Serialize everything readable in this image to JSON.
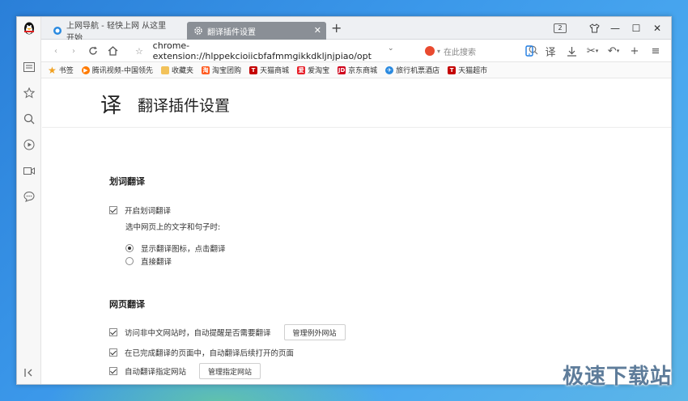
{
  "tabs": [
    {
      "label": "上网导航 - 轻快上网 从这里开始",
      "active": false
    },
    {
      "label": "翻译插件设置",
      "active": true
    }
  ],
  "tab_counter": "2",
  "address": {
    "url": "chrome-extension://hlppekcioiicbfafmmgikkdkljnjpiao/opt"
  },
  "search": {
    "placeholder": "在此搜索"
  },
  "toolbar": {
    "translate_label": "译"
  },
  "bookmarks": [
    {
      "label": "书签",
      "icon": "star-icon",
      "color": "#f0a020"
    },
    {
      "label": "腾讯视频-中国领先",
      "icon": "tencent-video-icon",
      "color": "#ff7a00"
    },
    {
      "label": "收藏夹",
      "icon": "folder-icon",
      "color": "#f2c25a"
    },
    {
      "label": "淘宝团购",
      "icon": "taobao-icon",
      "color": "#ff5a1f"
    },
    {
      "label": "天猫商城",
      "icon": "tmall-icon",
      "color": "#c40000"
    },
    {
      "label": "爱淘宝",
      "icon": "aitaobao-icon",
      "color": "#e8202a"
    },
    {
      "label": "京东商城",
      "icon": "jd-icon",
      "color": "#d0021b"
    },
    {
      "label": "旅行机票酒店",
      "icon": "travel-icon",
      "color": "#2a8ae0"
    },
    {
      "label": "天猫超市",
      "icon": "tmall-market-icon",
      "color": "#c40000"
    }
  ],
  "page": {
    "logo": "译",
    "title": "翻译插件设置",
    "sections": {
      "word": {
        "title": "划词翻译",
        "enable_label": "开启划词翻译",
        "hint": "选中网页上的文字和句子时:",
        "option_icon": "显示翻译图标，点击翻译",
        "option_direct": "直接翻译"
      },
      "web": {
        "title": "网页翻译",
        "auto_prompt": "访问非中文网站时，自动提醒是否需要翻译",
        "manage_except": "管理例外网站",
        "auto_continue": "在已完成翻译的页面中，自动翻译后续打开的页面",
        "auto_specified": "自动翻译指定网站",
        "manage_specified": "管理指定网站"
      }
    }
  },
  "watermark": "极速下载站"
}
